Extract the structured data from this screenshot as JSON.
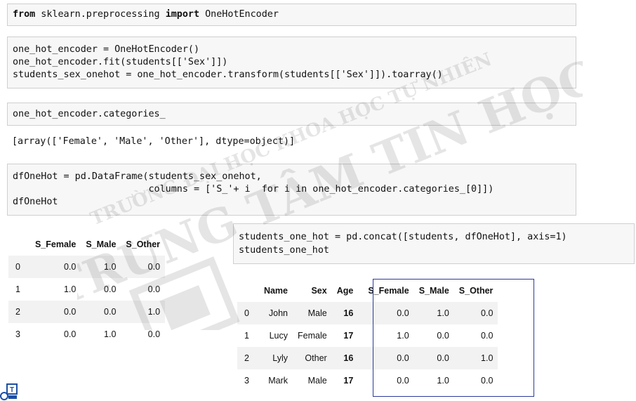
{
  "cells": {
    "import_line": {
      "kw1": "from",
      "mod": " sklearn.preprocessing ",
      "kw2": "import",
      "name": " OneHotEncoder"
    },
    "fit_block": [
      "one_hot_encoder = OneHotEncoder()",
      "one_hot_encoder.fit(students[['Sex']])",
      "students_sex_onehot = one_hot_encoder.transform(students[['Sex']]).toarray()"
    ],
    "categories_line": "one_hot_encoder.categories_",
    "categories_output": "[array(['Female', 'Male', 'Other'], dtype=object)]",
    "df_block": [
      "dfOneHot = pd.DataFrame(students_sex_onehot,",
      "                        columns = ['S_'+ i  for i in one_hot_encoder.categories_[0]])",
      "dfOneHot"
    ],
    "concat_block": [
      "students_one_hot = pd.concat([students, dfOneHot], axis=1)",
      "students_one_hot"
    ]
  },
  "onehot_table": {
    "columns": [
      "",
      "S_Female",
      "S_Male",
      "S_Other"
    ],
    "rows": [
      [
        "0",
        "0.0",
        "1.0",
        "0.0"
      ],
      [
        "1",
        "1.0",
        "0.0",
        "0.0"
      ],
      [
        "2",
        "0.0",
        "0.0",
        "1.0"
      ],
      [
        "3",
        "0.0",
        "1.0",
        "0.0"
      ]
    ]
  },
  "students_table": {
    "columns": [
      "",
      "Name",
      "Sex",
      "Age",
      "S_Female",
      "S_Male",
      "S_Other"
    ],
    "rows": [
      [
        "0",
        "John",
        "Male",
        "16",
        "0.0",
        "1.0",
        "0.0"
      ],
      [
        "1",
        "Lucy",
        "Female",
        "17",
        "1.0",
        "0.0",
        "0.0"
      ],
      [
        "2",
        "Lyly",
        "Other",
        "16",
        "0.0",
        "0.0",
        "1.0"
      ],
      [
        "3",
        "Mark",
        "Male",
        "17",
        "0.0",
        "1.0",
        "0.0"
      ]
    ]
  },
  "watermark": {
    "line1": "TRƯỜNG ĐẠI HỌC KHOA HỌC TỰ NHIÊN",
    "line2": "TRUNG TÂM TIN HỌC"
  },
  "logo": {
    "letter": "T"
  },
  "colors": {
    "highlight": "#2b3a9a",
    "cell_bg": "#f7f7f7"
  }
}
